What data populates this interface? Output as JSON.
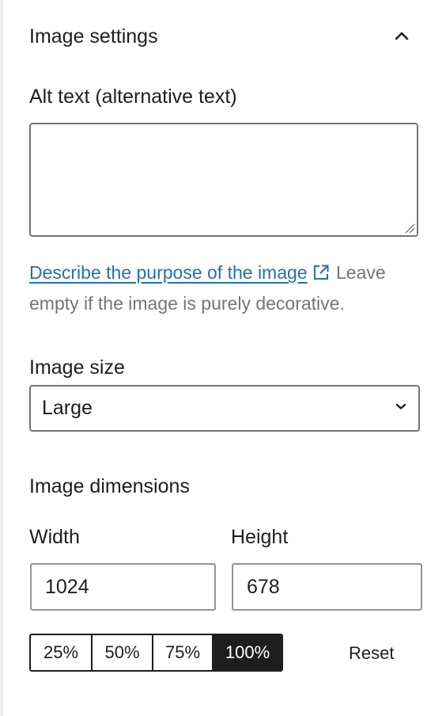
{
  "panel": {
    "title": "Image settings",
    "collapse_icon": "chevron-up-icon"
  },
  "alt_text": {
    "label": "Alt text (alternative text)",
    "value": "",
    "help_link": "Describe the purpose of the image",
    "help_suffix": " Leave empty if the image is purely decorative.",
    "external_icon": "external-link-icon"
  },
  "image_size": {
    "label": "Image size",
    "selected": "Large",
    "dropdown_icon": "chevron-down-icon"
  },
  "dimensions": {
    "label": "Image dimensions",
    "width_label": "Width",
    "width_value": "1024",
    "height_label": "Height",
    "height_value": "678",
    "percent_options": [
      "25%",
      "50%",
      "75%",
      "100%"
    ],
    "selected_percent": "100%",
    "reset_label": "Reset"
  },
  "colors": {
    "link": "#2271b1",
    "text": "#1e1e1e",
    "muted": "#757575",
    "active_bg": "#1e1e1e"
  }
}
